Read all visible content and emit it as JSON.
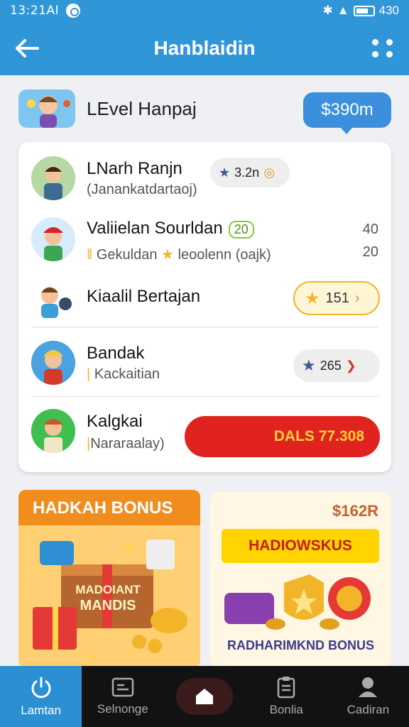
{
  "status": {
    "time": "13:21AI",
    "right": "430"
  },
  "header": {
    "title": "Hanblaidin"
  },
  "level": {
    "title": "LEvel Hanpaj",
    "balance": "$390m"
  },
  "rows": [
    {
      "name": "LNarh Ranjn",
      "sub": "(Janankatdartaoj)",
      "pill": "3.2n"
    },
    {
      "name": "Valiielan Sourldan",
      "badge": "20",
      "sub": "Gekuldan",
      "sub2": "leoolenn (oajk)",
      "num_top": "40",
      "num_bottom": "20"
    },
    {
      "name": "Kiaalil Bertajan",
      "pill": "151"
    },
    {
      "name": "Bandak",
      "sub": "Kackaitian",
      "pill": "265"
    },
    {
      "name": "Kalgkai",
      "sub": "Nararaalay)",
      "button": "DALS 77.308"
    }
  ],
  "bonus": {
    "left_banner": "HADKAH BONUS",
    "box_text_1": "MADOIANT",
    "box_text_2": "MANDIS",
    "right_price": "$162R",
    "right_ribbon": "HADIOWSKUS",
    "right_caption": "RADHARIMKND BONUS"
  },
  "nav": [
    {
      "label": "Lamtan"
    },
    {
      "label": "Selnonge"
    },
    {
      "label": ""
    },
    {
      "label": "Bonlia"
    },
    {
      "label": "Cadiran"
    }
  ],
  "colors": {
    "primary": "#2f96d8",
    "accent_red": "#e0231e",
    "accent_yellow": "#f2b52a"
  }
}
